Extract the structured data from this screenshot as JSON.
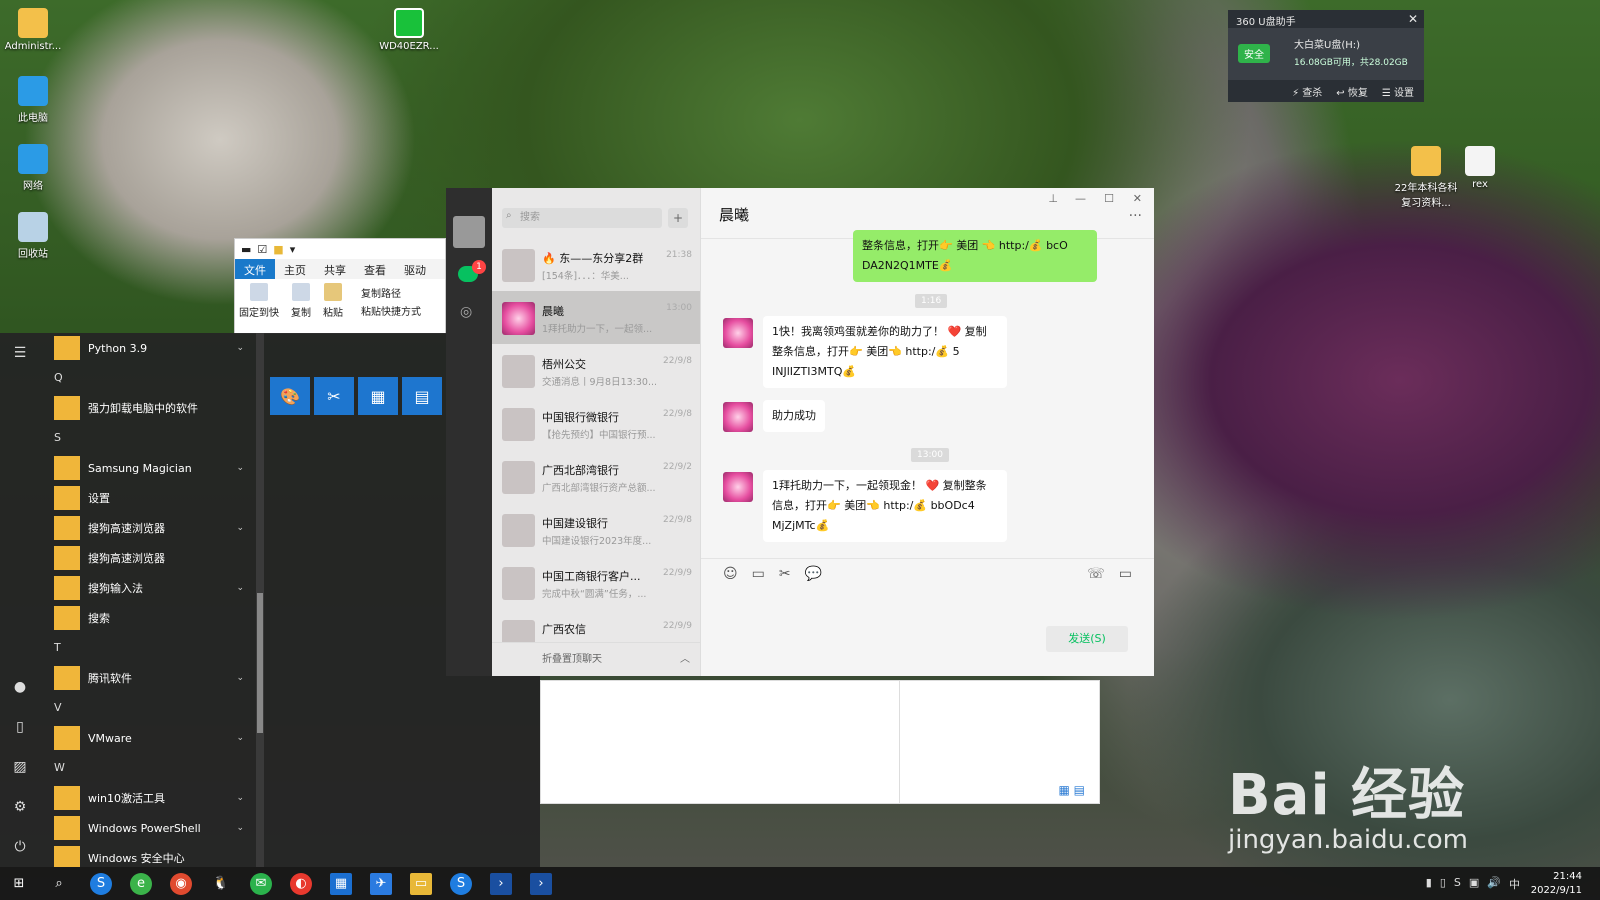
{
  "desktop": {
    "icons": [
      {
        "label": "Administr..."
      },
      {
        "label": "此电脑"
      },
      {
        "label": "网络"
      },
      {
        "label": "回收站"
      },
      {
        "label": "WD40EZR..."
      },
      {
        "label": "22年本科各科复习资料..."
      },
      {
        "label": "rex"
      }
    ]
  },
  "panel_360": {
    "title": "360 U盘助手",
    "badge": "安全",
    "drive": "大白菜U盘(H:)",
    "capacity": "16.08GB可用，共28.02GB",
    "actions": [
      "查杀",
      "恢复",
      "设置"
    ]
  },
  "explorer": {
    "tabs": [
      "文件",
      "主页",
      "共享",
      "查看",
      "驱动"
    ],
    "ribbon": {
      "pin": "固定到快",
      "copy": "复制",
      "paste": "粘贴",
      "copy_path": "复制路径",
      "paste_shortcut": "粘贴快捷方式"
    }
  },
  "start_menu": {
    "items": [
      {
        "type": "app",
        "label": "Python 3.9",
        "expand": true
      },
      {
        "type": "letter",
        "label": "Q"
      },
      {
        "type": "app",
        "label": "强力卸载电脑中的软件",
        "expand": false
      },
      {
        "type": "letter",
        "label": "S"
      },
      {
        "type": "app",
        "label": "Samsung Magician",
        "expand": true
      },
      {
        "type": "app",
        "label": "设置",
        "expand": false
      },
      {
        "type": "app",
        "label": "搜狗高速浏览器",
        "expand": true
      },
      {
        "type": "app",
        "label": "搜狗高速浏览器",
        "expand": false
      },
      {
        "type": "app",
        "label": "搜狗输入法",
        "expand": true
      },
      {
        "type": "app",
        "label": "搜索",
        "expand": false
      },
      {
        "type": "letter",
        "label": "T"
      },
      {
        "type": "app",
        "label": "腾讯软件",
        "expand": true
      },
      {
        "type": "letter",
        "label": "V"
      },
      {
        "type": "app",
        "label": "VMware",
        "expand": true
      },
      {
        "type": "letter",
        "label": "W"
      },
      {
        "type": "app",
        "label": "win10激活工具",
        "expand": true
      },
      {
        "type": "app",
        "label": "Windows PowerShell",
        "expand": true
      },
      {
        "type": "app",
        "label": "Windows 安全中心",
        "expand": false
      }
    ]
  },
  "wechat": {
    "search_placeholder": "搜索",
    "unread_badge": "1",
    "conversations": [
      {
        "name": "🔥 东——东分享2群",
        "preview": "[154条]．．．：华美...",
        "time": "21:38"
      },
      {
        "name": "晨曦",
        "preview": "1拜托助力一下，一起领...",
        "time": "13:00"
      },
      {
        "name": "梧州公交",
        "preview": "交通消息丨9月8日13:30...",
        "time": "22/9/8"
      },
      {
        "name": "中国银行微银行",
        "preview": "【抢先预约】中国银行预...",
        "time": "22/9/8"
      },
      {
        "name": "广西北部湾银行",
        "preview": "广西北部湾银行资产总额...",
        "time": "22/9/2"
      },
      {
        "name": "中国建设银行",
        "preview": "中国建设银行2023年度...",
        "time": "22/9/8"
      },
      {
        "name": "中国工商银行客户...",
        "preview": "完成中秋“圆满”任务，...",
        "time": "22/9/9"
      },
      {
        "name": "广西农信",
        "preview": "",
        "time": "22/9/9"
      }
    ],
    "fold_label": "折叠置顶聊天",
    "chat": {
      "title": "晨曦",
      "my_msg": "整条信息，打开👉 美团 👈 http:/💰 bcO DA2N2Q1MTE💰",
      "time1": "1:16",
      "msg1": "1快！我离领鸡蛋就差你的助力了！ ❤️ 复制 整条信息，打开👉 美团👈 http:/💰 5 INJlIZTI3MTQ💰",
      "msg2": "助力成功",
      "time2": "13:00",
      "msg3": "1拜托助力一下，一起领现金！ ❤️ 复制整条 信息，打开👉 美团👈 http:/💰 bbODc4 MjZjMTc💰",
      "send_label": "发送(S)"
    }
  },
  "taskbar": {
    "ime": "中",
    "time": "21:44",
    "date": "2022/9/11"
  },
  "watermark": {
    "brand": "Bai 经验",
    "url": "jingyan.baidu.com"
  }
}
